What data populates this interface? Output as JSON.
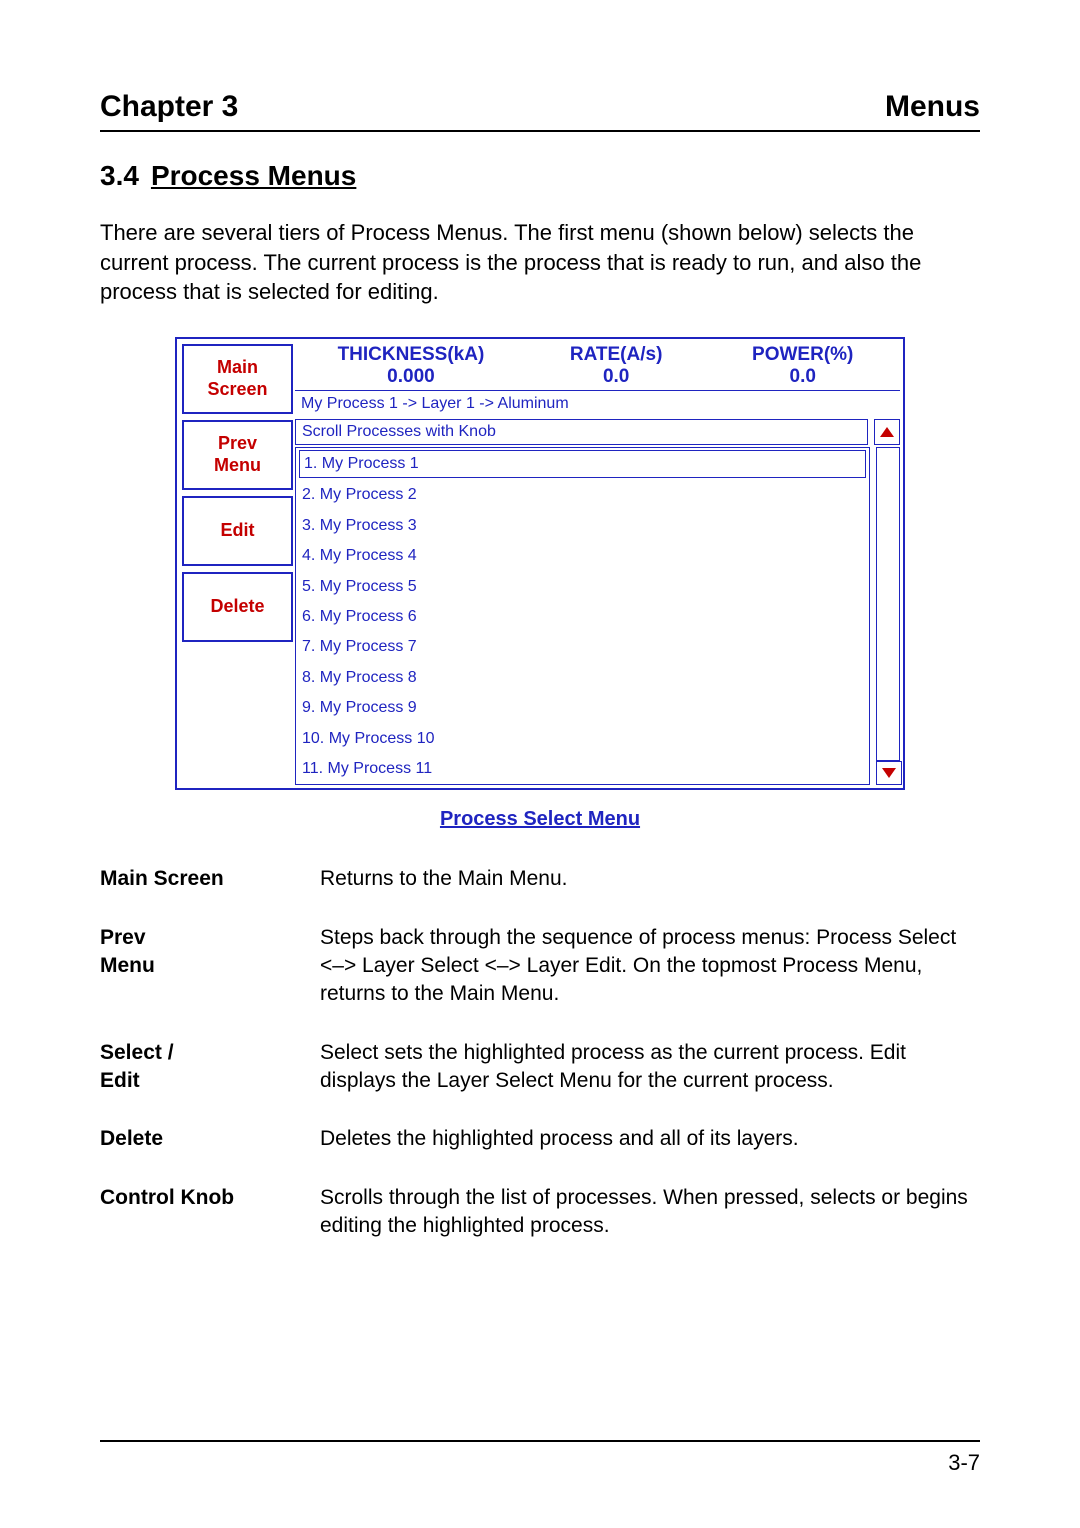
{
  "header": {
    "chapter": "Chapter 3",
    "right": "Menus"
  },
  "section": {
    "number": "3.4",
    "title": "Process Menus"
  },
  "intro": "There are several tiers of Process Menus.  The first menu (shown below) selects the current process.  The current process is the process that is ready to run, and also the process that is selected for editing.",
  "panel": {
    "side_buttons": {
      "main_line1": "Main",
      "main_line2": "Screen",
      "prev_line1": "Prev",
      "prev_line2": "Menu",
      "edit": "Edit",
      "delete": "Delete"
    },
    "stats": {
      "thickness_label": "THICKNESS(kA)",
      "thickness_val": "0.000",
      "rate_label": "RATE(A/s)",
      "rate_val": "0.0",
      "power_label": "POWER(%)",
      "power_val": "0.0"
    },
    "breadcrumb": "My Process 1 -> Layer 1 -> Aluminum",
    "scroll_label": "Scroll Processes with Knob",
    "processes": [
      "1. My Process 1",
      "2. My Process 2",
      "3. My Process 3",
      "4. My Process 4",
      "5. My Process 5",
      "6. My Process 6",
      "7. My Process 7",
      "8. My Process 8",
      "9. My Process 9",
      "10. My Process 10",
      "11. My Process 11"
    ],
    "selected_index": 0
  },
  "caption": "Process Select Menu",
  "definitions": [
    {
      "term": "Main Screen",
      "desc": "Returns to the Main Menu."
    },
    {
      "term": "Prev\nMenu",
      "desc": "Steps back through the sequence of process menus: Process Select <–> Layer Select <–> Layer Edit.  On the topmost Process Menu, returns to the Main Menu."
    },
    {
      "term": "Select /\nEdit",
      "desc": "Select sets the highlighted process as the current process.  Edit displays the Layer Select Menu for the current process."
    },
    {
      "term": "Delete",
      "desc": "Deletes the highlighted process and all of its layers."
    },
    {
      "term": "Control Knob",
      "desc": "Scrolls through the list of processes.  When pressed, selects or begins editing the highlighted process."
    }
  ],
  "page_number": "3-7"
}
